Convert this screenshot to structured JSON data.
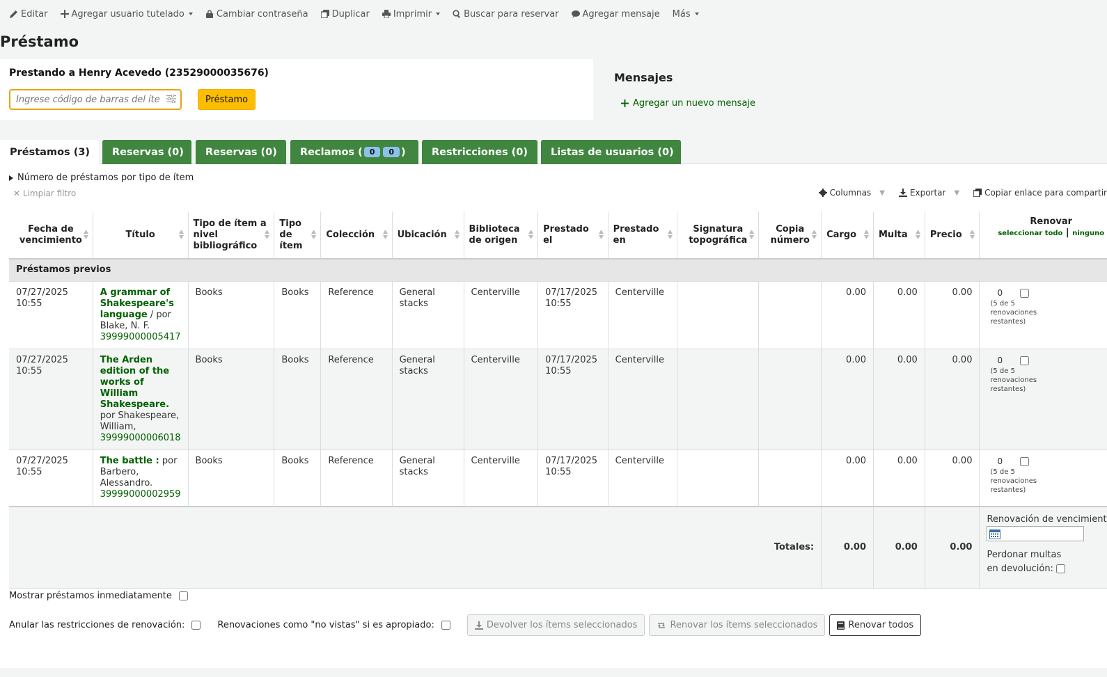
{
  "toolbar": {
    "edit": "Editar",
    "add_guarantee": "Agregar usuario tutelado",
    "change_password": "Cambiar contraseña",
    "duplicate": "Duplicar",
    "print": "Imprimir",
    "search_to_hold": "Buscar para reservar",
    "add_message": "Agregar mensaje",
    "more": "Más"
  },
  "page_title": "Préstamo",
  "checkout": {
    "title": "Prestando a Henry Acevedo (23529000035676)",
    "placeholder": "Ingrese código de barras del ítem",
    "button": "Préstamo"
  },
  "messages": {
    "heading": "Mensajes",
    "add_link": "Agregar un nuevo mensaje"
  },
  "tabs": [
    {
      "label": "Préstamos (3)"
    },
    {
      "label": "Reservas (0)"
    },
    {
      "label": "Reservas (0)"
    },
    {
      "label_prefix": "Reclamos (",
      "badge1": "0",
      "badge2": "0",
      "label_suffix": ")"
    },
    {
      "label": "Restricciones (0)"
    },
    {
      "label": "Listas de usuarios (0)"
    }
  ],
  "summary_toggle": "Número de préstamos por tipo de ítem",
  "clear_filter": "Limpiar filtro",
  "table_tools": {
    "columns": "Columnas",
    "export": "Exportar",
    "copy_link": "Copiar enlace para compartir"
  },
  "columns": {
    "due_date": "Fecha de vencimiento",
    "title": "Título",
    "biblio_itemtype": "Tipo de ítem a nivel bibliográfico",
    "itemtype": "Tipo de ítem",
    "collection": "Colección",
    "location": "Ubicación",
    "home_library": "Biblioteca de origen",
    "checked_out_on": "Prestado el",
    "checked_out_from": "Prestado en",
    "call_number": "Signatura topográfica",
    "copy_number": "Copia número",
    "charge": "Cargo",
    "fine": "Multa",
    "price": "Precio",
    "renew": "Renovar",
    "select_all": "seleccionar todo",
    "select_none": "ninguno"
  },
  "group_label": "Préstamos previos",
  "rows": [
    {
      "due_date": "07/27/2025 10:55",
      "title": "A grammar of Shakespeare's language",
      "author": " / por Blake, N. F.",
      "barcode": "39999000005417",
      "biblio_itemtype": "Books",
      "itemtype": "Books",
      "collection": "Reference",
      "location": "General stacks",
      "home_library": "Centerville",
      "checked_out_on": "07/17/2025 10:55",
      "checked_out_from": "Centerville",
      "call_number": "",
      "copy_number": "",
      "charge": "0.00",
      "fine": "0.00",
      "price": "0.00",
      "renewals": "0",
      "renewals_left": "(5 de 5 renovaciones restantes)"
    },
    {
      "due_date": "07/27/2025 10:55",
      "title": "The Arden edition of the works of William Shakespeare.",
      "author": " por Shakespeare, William,",
      "barcode": "39999000006018",
      "biblio_itemtype": "Books",
      "itemtype": "Books",
      "collection": "Reference",
      "location": "General stacks",
      "home_library": "Centerville",
      "checked_out_on": "07/17/2025 10:55",
      "checked_out_from": "Centerville",
      "call_number": "",
      "copy_number": "",
      "charge": "0.00",
      "fine": "0.00",
      "price": "0.00",
      "renewals": "0",
      "renewals_left": "(5 de 5 renovaciones restantes)"
    },
    {
      "due_date": "07/27/2025 10:55",
      "title": "The battle :",
      "author": " por Barbero, Alessandro.",
      "barcode": "39999000002959",
      "biblio_itemtype": "Books",
      "itemtype": "Books",
      "collection": "Reference",
      "location": "General stacks",
      "home_library": "Centerville",
      "checked_out_on": "07/17/2025 10:55",
      "checked_out_from": "Centerville",
      "call_number": "",
      "copy_number": "",
      "charge": "0.00",
      "fine": "0.00",
      "price": "0.00",
      "renewals": "0",
      "renewals_left": "(5 de 5 renovaciones restantes)"
    }
  ],
  "totals": {
    "label": "Totales:",
    "charge": "0.00",
    "fine": "0.00",
    "price": "0.00",
    "renewal_due_label": "Renovación de vencimiento:",
    "forgive_label": "Perdonar multas en devolución:"
  },
  "bottom": {
    "show_immediately": "Mostrar préstamos inmediatamente",
    "override_restrictions": "Anular las restricciones de renovación:",
    "unseen_renewals": "Renovaciones como \"no vistas\" si es apropiado:",
    "checkin_selected": "Devolver los ítems seleccionados",
    "renew_selected": "Renovar los ítems seleccionados",
    "renew_all": "Renovar todos"
  }
}
